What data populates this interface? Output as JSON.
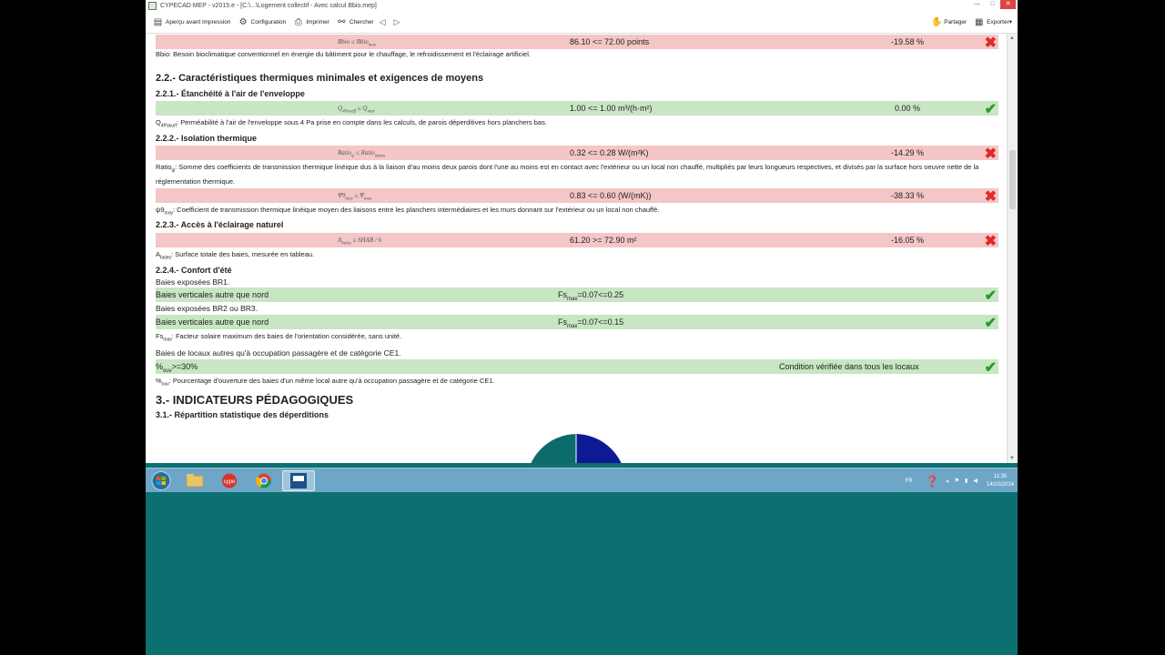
{
  "window": {
    "title": "CYPECAD MEP - v2015.e - [C:\\...\\Logement collectif - Avec calcul Bbio.mep]",
    "buttons": [
      "—",
      "□",
      "✕"
    ]
  },
  "toolbar": {
    "items": [
      {
        "label": "Aperçu avant impression",
        "icon": "print-preview-icon"
      },
      {
        "label": "Configuration",
        "icon": "gear-icon"
      },
      {
        "label": "Imprimer",
        "icon": "printer-icon"
      },
      {
        "label": "Chercher",
        "icon": "binoculars-icon"
      }
    ],
    "back": "◁",
    "forward": "▷",
    "share_label": "Partager",
    "export_label": "Exporter▾"
  },
  "report": {
    "bbio_row": {
      "formula": "Bbio ≤ Bbio",
      "formula_sub": "max",
      "value": "86.10 <= 72.00 points",
      "pct": "-19.58 %",
      "status": "fail"
    },
    "bbio_note": "Bbio: Besoin bioclimatique conventionnel en énergie du bâtiment pour le chauffage, le refroidissement et l'éclairage artificiel.",
    "section_22": "2.2.- Caractéristiques thermiques minimales et exigences de moyens",
    "section_221": "2.2.1.- Étanchéité à l'air de l'enveloppe",
    "q_row": {
      "formula": "Q",
      "formula_sub": "4Paseff",
      "formula_rest": " ≤ Q",
      "formula_sub2": "max",
      "value": "1.00 <= 1.00 m³/(h·m²)",
      "pct": "0.00 %",
      "status": "ok"
    },
    "q_note_sym": "Q",
    "q_note_sub": "4Pasurf",
    "q_note": ": Perméabilité à l'air de l'enveloppe sous 4 Pa prise en compte dans les calculs, de parois déperditives hors planchers bas.",
    "section_222": "2.2.2.- Isolation thermique",
    "ratio_row": {
      "formula": "Ratio",
      "formula_sub": "ψ",
      "formula_rest": " ≤ Ratio",
      "formula_sub2": "ψmax",
      "value": "0.32 <= 0.28 W/(m²K)",
      "pct": "-14.29 %",
      "status": "fail"
    },
    "ratio_note_sym": "Ratio",
    "ratio_note_sub": "ψ",
    "ratio_note": ": Somme des coefficients de transmission thermique linéique dus à la liaison d'au moins deux parois dont l'une au moins est en contact avec l'extérieur ou un local non chauffé, multipliés par leurs longueurs respectives, et divisés par la surface hors oeuvre nette de la réglementation thermique.",
    "psi_row": {
      "formula": "Ψ9",
      "formula_sub": "moy",
      "formula_rest": " ≤ Ψ",
      "formula_sub2": "max",
      "value": "0.83 <= 0.60 (W/(mK))",
      "pct": "-38.33 %",
      "status": "fail"
    },
    "psi_note_sym": "ψ9",
    "psi_note_sub": "moy",
    "psi_note": ": Coefficient de transmission thermique linéique moyen des liaisons entre les planchers intermédiaires et les murs donnant sur l'extérieur ou un local non chauffé.",
    "section_223": "2.2.3.- Accès à l'éclairage naturel",
    "abaies_row": {
      "formula": "A",
      "formula_sub": "baies",
      "formula_rest": " ≥ SHAB / 6",
      "value": "61.20 >= 72.90 m²",
      "pct": "-16.05 %",
      "status": "fail"
    },
    "abaies_note_sym": "A",
    "abaies_note_sub": "baies",
    "abaies_note": ": Surface totale des baies, mesurée en tableau.",
    "section_224": "2.2.4.- Confort d'été",
    "baies_br1": "Baies exposées BR1.",
    "fs_row1": {
      "label": "Baies verticales autre que nord",
      "fs": "Fs",
      "fs_sub": "max",
      "fs_rest": "=0.07<=0.25",
      "status": "ok"
    },
    "baies_br2": "Baies exposées BR2 ou BR3.",
    "fs_row2": {
      "label": "Baies verticales autre que nord",
      "fs": "Fs",
      "fs_sub": "max",
      "fs_rest": "=0.07<=0.15",
      "status": "ok"
    },
    "fs_note_sym": "Fs",
    "fs_note_sub": "max",
    "fs_note": ": Facteur solaire maximum des baies de l'orientation considérée, sans unité.",
    "baies_ce1": "Baies de locaux autres qu'à occupation passagère et de catégorie CE1.",
    "ouv_row": {
      "label": "%",
      "label_sub": "ouv",
      "label_rest": ">=30%",
      "right": "Condition vérifiée dans tous les locaux",
      "status": "ok"
    },
    "ouv_note_sym": "%",
    "ouv_note_sub": "ouv",
    "ouv_note": ": Pourcentage d'ouverture des baies d'un même local autre qu'à occupation passagère et de catégorie CE1.",
    "section_3": "3.- INDICATEURS PÉDAGOGIQUES",
    "section_31": "3.1.- Répartition statistique des déperditions",
    "fail_mark": "✖",
    "ok_mark": "✔"
  },
  "pie_colors": {
    "left": "#0e6b6b",
    "right": "#0c1a96"
  },
  "taskbar": {
    "lang": "FR",
    "time": "11:35",
    "date": "14/10/2014",
    "apps": [
      "start-orb",
      "file-explorer",
      "cype-app",
      "chrome",
      "mep-app"
    ],
    "mep_label": "MEP"
  }
}
